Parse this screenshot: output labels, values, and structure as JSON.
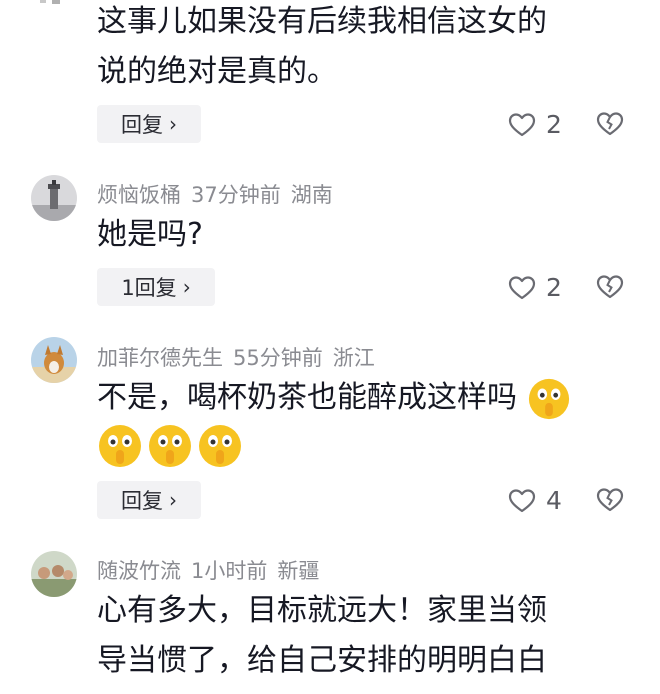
{
  "comments": [
    {
      "text_lines": [
        "这事儿如果没有后续我相信这女的",
        "说的绝对是真的。"
      ],
      "reply_label": "回复",
      "likes": "2"
    },
    {
      "username": "烦恼饭桶",
      "time": "37分钟前",
      "location": "湖南",
      "text": "她是吗?",
      "reply_label": "1回复",
      "likes": "2",
      "avatar_icon": "lighthouse-avatar"
    },
    {
      "username": "加菲尔德先生",
      "time": "55分钟前",
      "location": "浙江",
      "text": "不是，喝杯奶茶也能醉成这样吗",
      "emoji": "shush-emoji",
      "reply_label": "回复",
      "likes": "4",
      "avatar_icon": "corgi-avatar"
    },
    {
      "username": "随波竹流",
      "time": "1小时前",
      "location": "新疆",
      "text_lines": [
        "心有多大，目标就远大！家里当领",
        "导当惯了，给自己安排的明明白白"
      ],
      "avatar_icon": "group-photo-avatar"
    }
  ],
  "colors": {
    "text": "#161823",
    "meta": "#8a8b91",
    "button_bg": "#f2f2f4",
    "icon": "#6a6b72"
  }
}
